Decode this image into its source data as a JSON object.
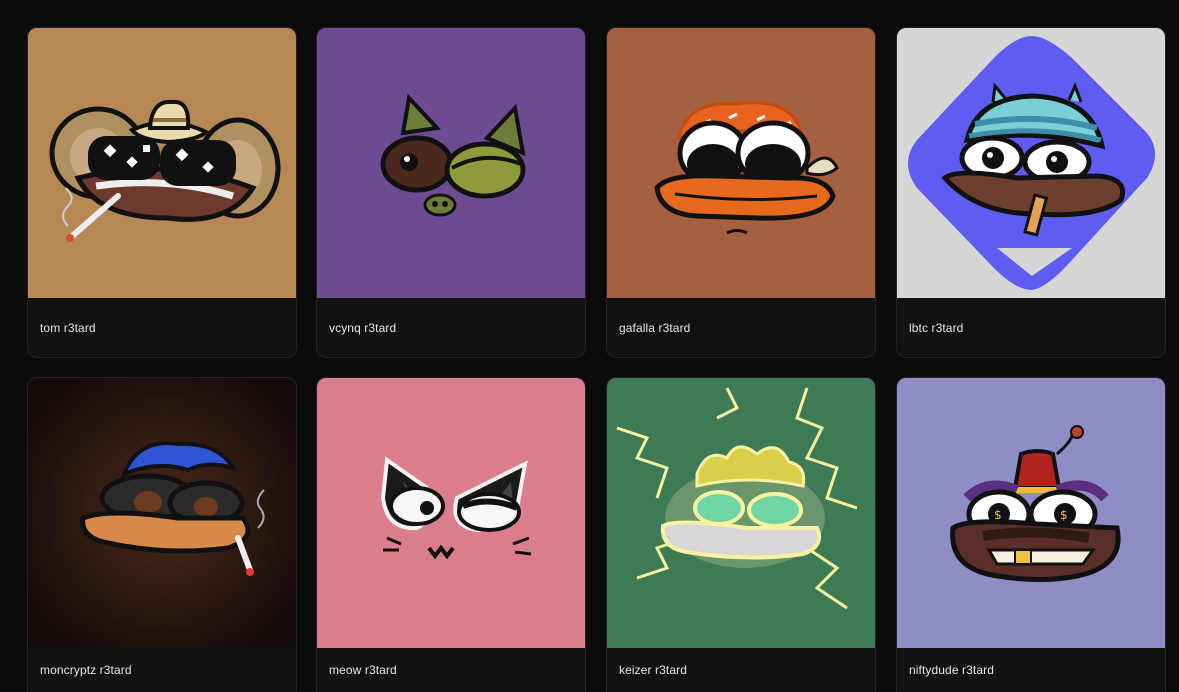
{
  "gallery": {
    "items": [
      {
        "name": "tom r3tard",
        "bg": "#b88756",
        "art": "monkey-with-hat"
      },
      {
        "name": "vcynq r3tard",
        "bg": "#6e4c93",
        "art": "green-cat-eyes"
      },
      {
        "name": "gafalla r3tard",
        "bg": "#a4603f",
        "art": "orange-hair-duck"
      },
      {
        "name": "lbtc r3tard",
        "bg": "#d6d6d6",
        "accent": "#5e5cf2",
        "art": "striped-cap-blue-badge"
      },
      {
        "name": "moncryptz r3tard",
        "bg": "#2a1612",
        "art": "blue-hair-sunglasses"
      },
      {
        "name": "meow r3tard",
        "bg": "#db7d8d",
        "art": "black-cat-ears"
      },
      {
        "name": "keizer r3tard",
        "bg": "#3d7a55",
        "art": "lightning-glow"
      },
      {
        "name": "niftydude r3tard",
        "bg": "#8f8dc5",
        "art": "fez-dollar-eyes"
      }
    ]
  }
}
